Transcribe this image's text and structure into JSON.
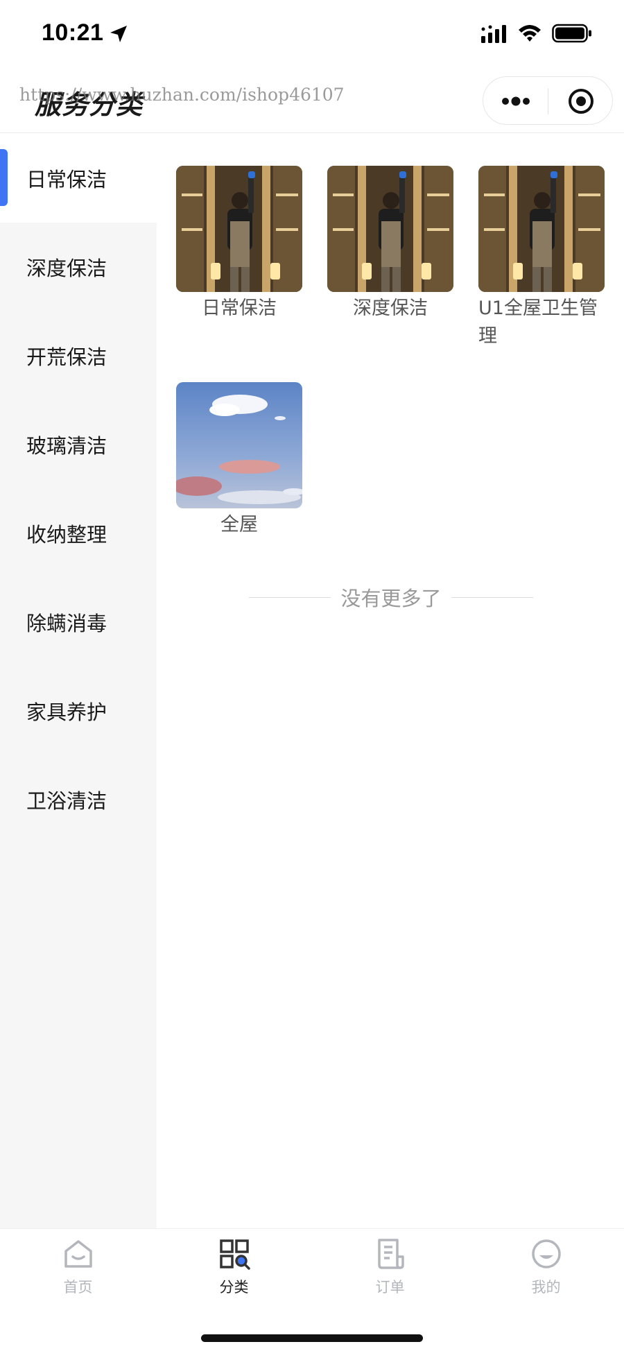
{
  "status_bar": {
    "time": "10:21",
    "location_icon": "location-arrow-icon",
    "signal_icon": "cellular-signal-icon",
    "wifi_icon": "wifi-icon",
    "battery_icon": "battery-full-icon"
  },
  "header": {
    "title": "服务分类",
    "watermark": "https://www.huzhan.com/ishop46107",
    "more_icon": "more-dots-icon",
    "close_icon": "target-close-icon"
  },
  "sidebar": {
    "active_color": "#3f74f4",
    "items": [
      {
        "label": "日常保洁",
        "active": true
      },
      {
        "label": "深度保洁",
        "active": false
      },
      {
        "label": "开荒保洁",
        "active": false
      },
      {
        "label": "玻璃清洁",
        "active": false
      },
      {
        "label": "收纳整理",
        "active": false
      },
      {
        "label": "除螨消毒",
        "active": false
      },
      {
        "label": "家具养护",
        "active": false
      },
      {
        "label": "卫浴清洁",
        "active": false
      }
    ]
  },
  "content": {
    "cards": [
      {
        "label": "日常保洁",
        "image": "cleaner-photo"
      },
      {
        "label": "深度保洁",
        "image": "cleaner-photo"
      },
      {
        "label": "U1全屋卫生管理",
        "image": "cleaner-photo"
      },
      {
        "label": "全屋",
        "image": "sky-photo"
      }
    ],
    "end_text": "没有更多了"
  },
  "tabbar": {
    "tabs": [
      {
        "label": "首页",
        "icon": "home-icon",
        "active": false
      },
      {
        "label": "分类",
        "icon": "category-grid-icon",
        "active": true
      },
      {
        "label": "订单",
        "icon": "order-document-icon",
        "active": false
      },
      {
        "label": "我的",
        "icon": "profile-face-icon",
        "active": false
      }
    ]
  }
}
